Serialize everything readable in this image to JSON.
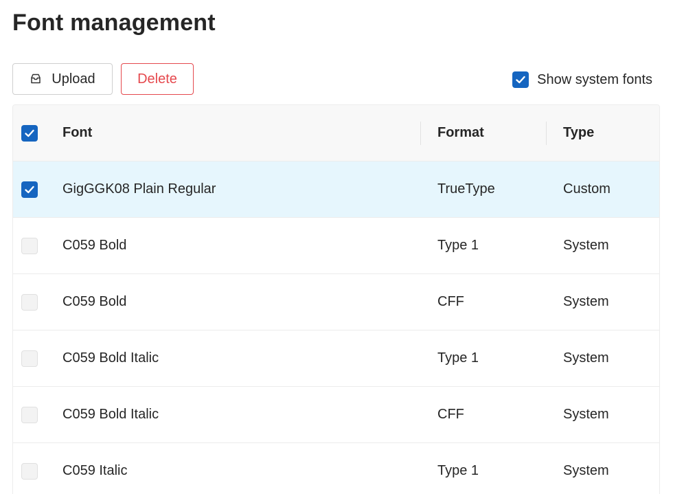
{
  "page": {
    "title": "Font management"
  },
  "toolbar": {
    "upload_label": "Upload",
    "delete_label": "Delete",
    "show_system_label": "Show system fonts",
    "show_system_checked": true,
    "upload_icon": "upload-tray-icon"
  },
  "colors": {
    "accent": "#1565c0",
    "danger": "#e5484d",
    "selected_row": "#e6f6fd",
    "header_bg": "#f8f8f8"
  },
  "table": {
    "select_all_checked": true,
    "headers": {
      "font": "Font",
      "format": "Format",
      "type": "Type"
    },
    "rows": [
      {
        "font": "GigGGK08 Plain Regular",
        "format": "TrueType",
        "type": "Custom",
        "checked": true
      },
      {
        "font": "C059 Bold",
        "format": "Type 1",
        "type": "System",
        "checked": false
      },
      {
        "font": "C059 Bold",
        "format": "CFF",
        "type": "System",
        "checked": false
      },
      {
        "font": "C059 Bold Italic",
        "format": "Type 1",
        "type": "System",
        "checked": false
      },
      {
        "font": "C059 Bold Italic",
        "format": "CFF",
        "type": "System",
        "checked": false
      },
      {
        "font": "C059 Italic",
        "format": "Type 1",
        "type": "System",
        "checked": false
      }
    ]
  }
}
